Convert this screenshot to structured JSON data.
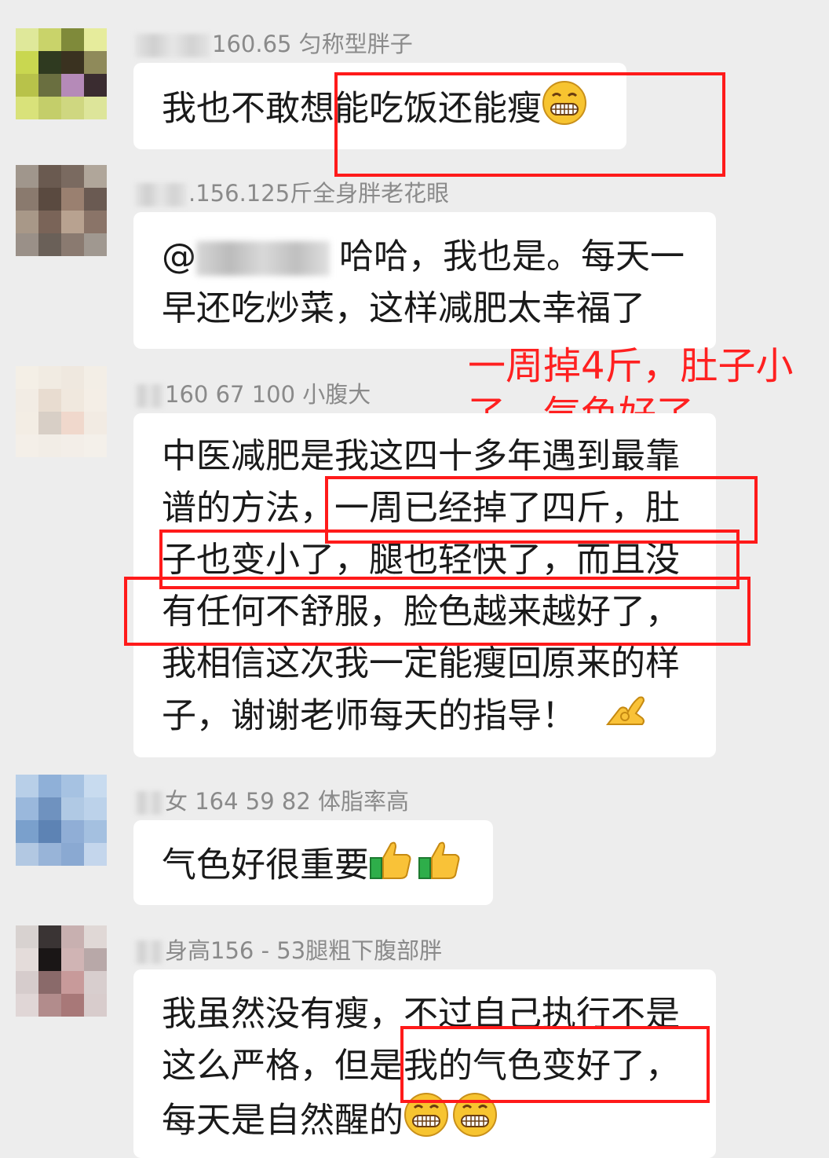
{
  "messages": [
    {
      "nickname": "160.65  匀称型胖子",
      "lines": [
        "我也不敢想能吃饭还能瘦"
      ],
      "emoji": [
        "grin"
      ]
    },
    {
      "nickname": ".156.125斤全身胖老花眼",
      "mention_prefix": "@",
      "lines": [
        "哈哈，我也是。每天一",
        "早还吃炒菜，这样减肥太幸福了"
      ]
    },
    {
      "nickname": "160 67 100 小腹大",
      "lines": [
        "中医减肥是我这四十多年遇到最靠",
        "谱的方法，一周已经掉了四斤，肚",
        "子也变小了，腿也轻快了，而且没",
        "有任何不舒服，脸色越来越好了，",
        "我相信这次我一定能瘦回原来的样",
        "子，谢谢老师每天的指导！"
      ],
      "emoji": [
        "ok-hand"
      ]
    },
    {
      "nickname": "女 164 59 82 体脂率高",
      "lines": [
        "气色好很重要"
      ],
      "emoji": [
        "thumbs-up",
        "thumbs-up"
      ]
    },
    {
      "nickname": "身高156 - 53腿粗下腹部胖",
      "lines": [
        "我虽然没有瘦，不过自己执行不是",
        "这么严格，但是我的气色变好了，",
        "每天是自然醒的"
      ],
      "emoji": [
        "grin",
        "grin"
      ]
    }
  ],
  "annotation": {
    "lines": [
      "一周掉4斤，肚子小",
      "了，气色好了"
    ],
    "color": "#ff2020"
  },
  "colors": {
    "background": "#ededed",
    "bubble": "#ffffff",
    "highlight": "#ff1a1a"
  }
}
